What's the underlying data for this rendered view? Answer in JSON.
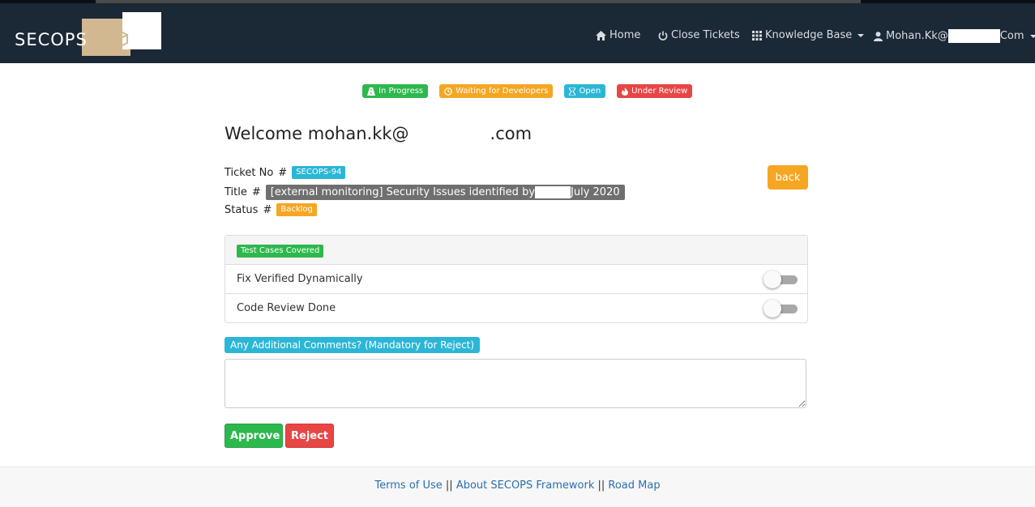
{
  "brand": {
    "logo_text": "SECOPS"
  },
  "nav": {
    "home": "Home",
    "close_tickets": "Close Tickets",
    "knowledge_base": "Knowledge Base",
    "user_prefix": "Mohan.Kk@",
    "user_suffix": "Com"
  },
  "legend": [
    {
      "label": "In Progress",
      "color": "#2db84d",
      "icon": "road-icon"
    },
    {
      "label": "Waiting for Developers",
      "color": "#f5a623",
      "icon": "clock-icon"
    },
    {
      "label": "Open",
      "color": "#2cb6d6",
      "icon": "hourglass-icon"
    },
    {
      "label": "Under Review",
      "color": "#e84545",
      "icon": "fire-icon"
    }
  ],
  "welcome": {
    "prefix": "Welcome mohan.kk@",
    "suffix": ".com"
  },
  "ticket": {
    "no_label": "Ticket No",
    "no_value": "SECOPS-94",
    "title_label": "Title",
    "title_part1": "[external monitoring] Security Issues identified by",
    "title_part2": "July 2020",
    "status_label": "Status",
    "status_value": "Backlog",
    "hash": "#"
  },
  "back_button": "back",
  "checklist": {
    "header_badge": "Test Cases Covered",
    "items": [
      {
        "label": "Fix Verified Dynamically",
        "checked": false
      },
      {
        "label": "Code Review Done",
        "checked": false
      }
    ]
  },
  "comments": {
    "label": "Any Additional Comments? (Mandatory for Reject)",
    "value": ""
  },
  "actions": {
    "approve": "Approve",
    "reject": "Reject"
  },
  "footer": {
    "terms": "Terms of Use",
    "about": "About SECOPS Framework",
    "roadmap": "Road Map",
    "separator": "||"
  },
  "colors": {
    "navbar": "#1b2836",
    "green": "#2db84d",
    "orange": "#f5a623",
    "cyan": "#2cb6d6",
    "red": "#e84545"
  }
}
